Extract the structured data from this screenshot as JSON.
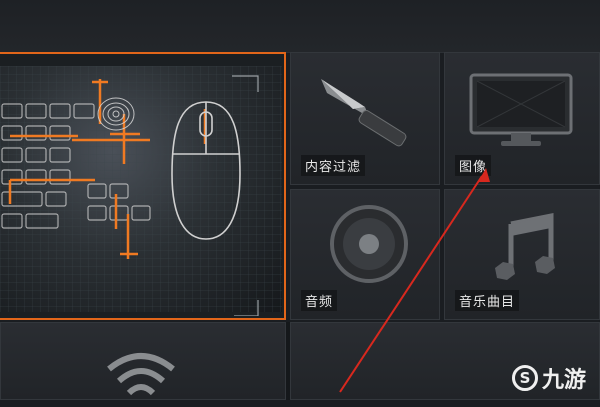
{
  "tiles": [
    {
      "label": "内容过滤",
      "icon": "knife-icon"
    },
    {
      "label": "图像",
      "icon": "monitor-icon"
    },
    {
      "label": "音频",
      "icon": "speaker-icon"
    },
    {
      "label": "音乐曲目",
      "icon": "music-note-icon"
    }
  ],
  "feature": {
    "icon": "keyboard-mouse-icon"
  },
  "bottom": {
    "icon": "wifi-icon"
  },
  "watermark": {
    "text": "九游",
    "logo_mark": "S"
  },
  "colors": {
    "accent": "#e2661a",
    "annotation_arrow": "#d8281e"
  }
}
